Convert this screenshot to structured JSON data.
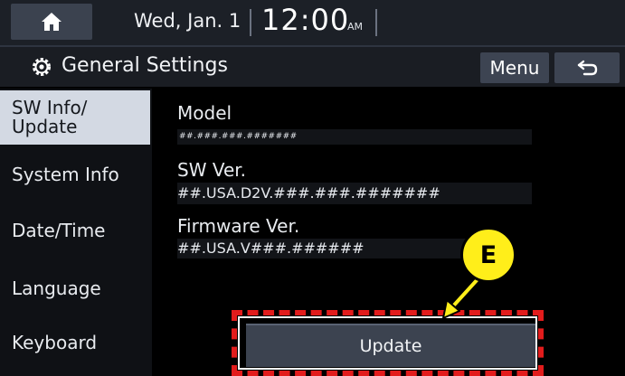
{
  "status": {
    "date": "Wed, Jan. 1",
    "time": "12:00",
    "ampm": "AM"
  },
  "header": {
    "title": "General Settings",
    "menu_label": "Menu"
  },
  "sidebar": {
    "items": [
      {
        "label": "SW Info/\nUpdate",
        "active": true
      },
      {
        "label": "System Info",
        "active": false
      },
      {
        "label": "Date/Time",
        "active": false
      },
      {
        "label": "Language",
        "active": false
      },
      {
        "label": "Keyboard",
        "active": false
      }
    ]
  },
  "main": {
    "model_label": "Model",
    "model_value": "##.###.###.#######",
    "sw_label": "SW Ver.",
    "sw_value": "##.USA.D2V.###.###.#######",
    "firmware_label": "Firmware Ver.",
    "firmware_value": "##.USA.V###.######",
    "update_label": "Update"
  },
  "annotation": {
    "callout_letter": "E"
  },
  "colors": {
    "active_tab": "#d3d9e3",
    "button": "#3d4452",
    "highlight": "#e21c1c",
    "callout": "#ffee1a"
  },
  "icons": [
    "home-icon",
    "gear-icon",
    "back-arrow-icon"
  ]
}
